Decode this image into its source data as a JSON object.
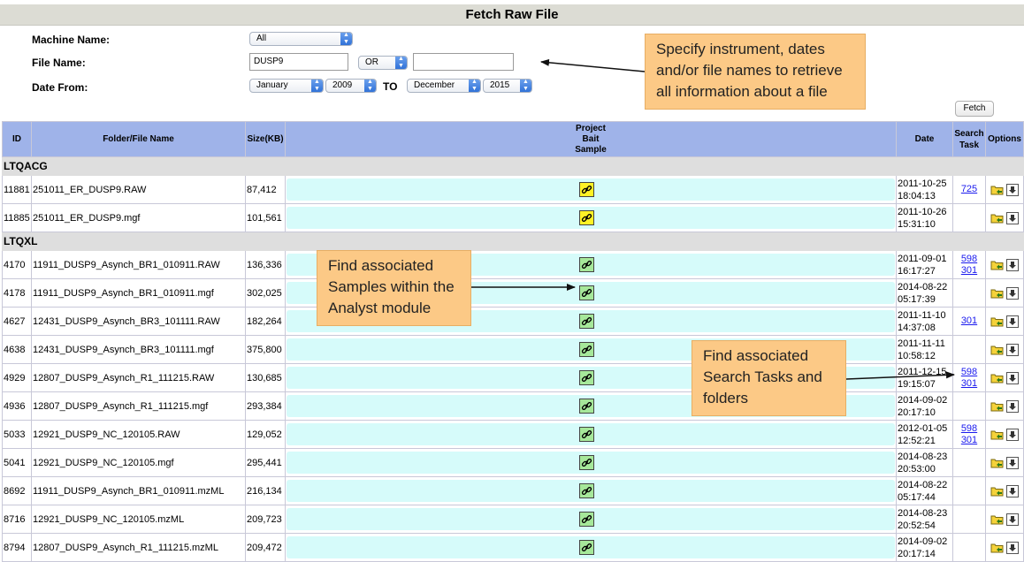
{
  "title": "Fetch Raw File",
  "form": {
    "machine_label": "Machine Name:",
    "machine_value": "All",
    "file_label": "File Name:",
    "file_value": "DUSP9",
    "op_value": "OR",
    "file_value2": "",
    "date_label": "Date From:",
    "from_month": "January",
    "from_year": "2009",
    "to_label": "TO",
    "to_month": "December",
    "to_year": "2015",
    "fetch_label": "Fetch"
  },
  "callouts": {
    "specify": "Specify instrument, dates and/or file names to retrieve all information about a file",
    "samples": "Find associated Samples within the Analyst module",
    "tasks": "Find associated Search Tasks and folders"
  },
  "table": {
    "headers": {
      "id": "ID",
      "file": "Folder/File Name",
      "size": "Size(KB)",
      "project": "Project",
      "bait": "Bait",
      "sample": "Sample",
      "date": "Date",
      "search": "Search",
      "task": "Task",
      "options": "Options"
    },
    "groups": [
      {
        "name": "LTQACG",
        "rows": [
          {
            "id": "11881",
            "file": "251011_ER_DUSP9.RAW",
            "size": "87,412",
            "date1": "2011-10-25",
            "date2": "18:04:13",
            "tasks": [
              "725"
            ],
            "icon": "yellow"
          },
          {
            "id": "11885",
            "file": "251011_ER_DUSP9.mgf",
            "size": "101,561",
            "date1": "2011-10-26",
            "date2": "15:31:10",
            "tasks": [],
            "icon": "yellow"
          }
        ]
      },
      {
        "name": "LTQXL",
        "rows": [
          {
            "id": "4170",
            "file": "11911_DUSP9_Asynch_BR1_010911.RAW",
            "size": "136,336",
            "date1": "2011-09-01",
            "date2": "16:17:27",
            "tasks": [
              "598",
              "301"
            ],
            "icon": "green"
          },
          {
            "id": "4178",
            "file": "11911_DUSP9_Asynch_BR1_010911.mgf",
            "size": "302,025",
            "date1": "2014-08-22",
            "date2": "05:17:39",
            "tasks": [],
            "icon": "green"
          },
          {
            "id": "4627",
            "file": "12431_DUSP9_Asynch_BR3_101111.RAW",
            "size": "182,264",
            "date1": "2011-11-10",
            "date2": "14:37:08",
            "tasks": [
              "301"
            ],
            "icon": "green"
          },
          {
            "id": "4638",
            "file": "12431_DUSP9_Asynch_BR3_101111.mgf",
            "size": "375,800",
            "date1": "2011-11-11",
            "date2": "10:58:12",
            "tasks": [],
            "icon": "green"
          },
          {
            "id": "4929",
            "file": "12807_DUSP9_Asynch_R1_111215.RAW",
            "size": "130,685",
            "date1": "2011-12-15",
            "date2": "19:15:07",
            "tasks": [
              "598",
              "301"
            ],
            "icon": "green"
          },
          {
            "id": "4936",
            "file": "12807_DUSP9_Asynch_R1_111215.mgf",
            "size": "293,384",
            "date1": "2014-09-02",
            "date2": "20:17:10",
            "tasks": [],
            "icon": "green"
          },
          {
            "id": "5033",
            "file": "12921_DUSP9_NC_120105.RAW",
            "size": "129,052",
            "date1": "2012-01-05",
            "date2": "12:52:21",
            "tasks": [
              "598",
              "301"
            ],
            "icon": "green"
          },
          {
            "id": "5041",
            "file": "12921_DUSP9_NC_120105.mgf",
            "size": "295,441",
            "date1": "2014-08-23",
            "date2": "20:53:00",
            "tasks": [],
            "icon": "green"
          },
          {
            "id": "8692",
            "file": "11911_DUSP9_Asynch_BR1_010911.mzML",
            "size": "216,134",
            "date1": "2014-08-22",
            "date2": "05:17:44",
            "tasks": [],
            "icon": "green"
          },
          {
            "id": "8716",
            "file": "12921_DUSP9_NC_120105.mzML",
            "size": "209,723",
            "date1": "2014-08-23",
            "date2": "20:52:54",
            "tasks": [],
            "icon": "green"
          },
          {
            "id": "8794",
            "file": "12807_DUSP9_Asynch_R1_111215.mzML",
            "size": "209,472",
            "date1": "2014-09-02",
            "date2": "20:17:14",
            "tasks": [],
            "icon": "green"
          }
        ]
      }
    ]
  },
  "icons": {
    "link": "link-icon",
    "folder": "folder-icon",
    "download": "download-icon",
    "dropdown": "chevron-updown-icon"
  },
  "colors": {
    "header_bg": "#9fb3e9",
    "group_bg": "#dedede",
    "bar_bg": "#d6fbfa",
    "callout_bg": "#fcc986",
    "link_yellow": "#fff226",
    "link_green": "#a6e89a"
  }
}
